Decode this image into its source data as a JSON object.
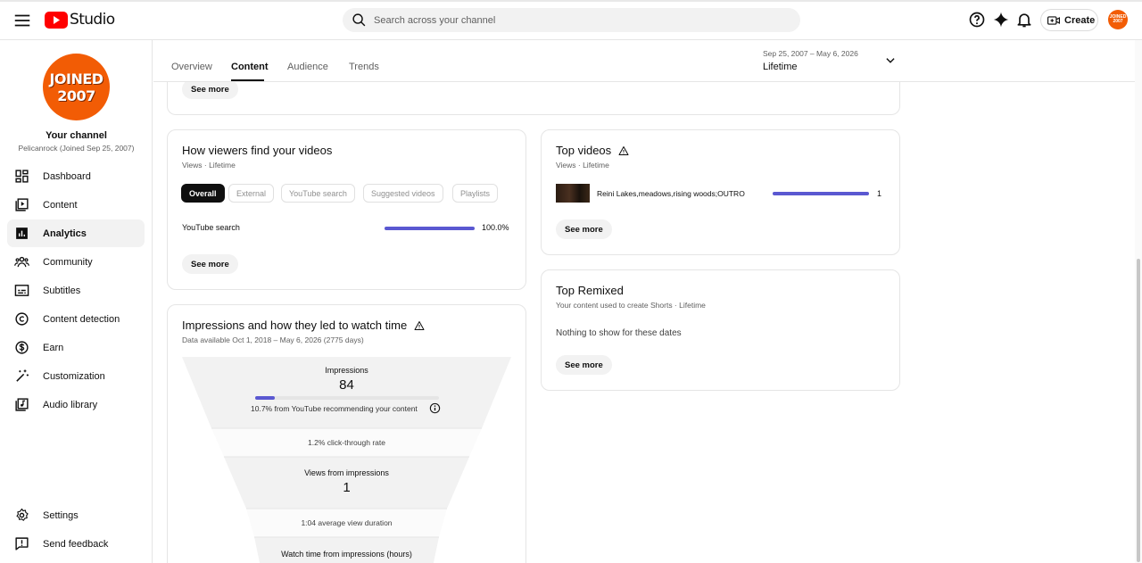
{
  "header": {
    "logo_text": "Studio",
    "search_placeholder": "Search across your channel",
    "create_label": "Create",
    "avatar_text": "JOINED 2007"
  },
  "channel": {
    "avatar_line1": "JOINED",
    "avatar_line2": "2007",
    "title": "Your channel",
    "subtitle": "Pelicanrock (Joined Sep 25, 2007)"
  },
  "sidebar": {
    "items": [
      {
        "label": "Dashboard",
        "icon": "dashboard-icon"
      },
      {
        "label": "Content",
        "icon": "content-icon"
      },
      {
        "label": "Analytics",
        "icon": "analytics-icon",
        "active": true
      },
      {
        "label": "Community",
        "icon": "community-icon"
      },
      {
        "label": "Subtitles",
        "icon": "subtitles-icon"
      },
      {
        "label": "Content detection",
        "icon": "copyright-icon"
      },
      {
        "label": "Earn",
        "icon": "dollar-icon"
      },
      {
        "label": "Customization",
        "icon": "magic-wand-icon"
      },
      {
        "label": "Audio library",
        "icon": "audio-library-icon"
      }
    ],
    "settings_label": "Settings",
    "feedback_label": "Send feedback"
  },
  "tabs": [
    "Overview",
    "Content",
    "Audience",
    "Trends"
  ],
  "active_tab": "Content",
  "date_range": {
    "range": "Sep 25, 2007 – May 6, 2026",
    "label": "Lifetime"
  },
  "top_card": {
    "see_more": "See more"
  },
  "viewers_card": {
    "title": "How viewers find your videos",
    "subtitle": "Views · Lifetime",
    "chips": [
      "Overall",
      "External",
      "YouTube search",
      "Suggested videos",
      "Playlists"
    ],
    "active_chip": "Overall",
    "row_label": "YouTube search",
    "row_value": "100.0%",
    "row_fraction": 1.0,
    "see_more": "See more"
  },
  "impressions_card": {
    "title": "Impressions and how they led to watch time",
    "subtitle": "Data available Oct 1, 2018 – May 6, 2026 (2775 days)",
    "impressions_label": "Impressions",
    "impressions_value": "84",
    "recommend_text": "10.7% from YouTube recommending your content",
    "recommend_fraction": 0.107,
    "ctr_text": "1.2% click-through rate",
    "views_label": "Views from impressions",
    "views_value": "1",
    "avg_duration_text": "1:04 average view duration",
    "watch_time_label": "Watch time from impressions (hours)"
  },
  "top_videos_card": {
    "title": "Top videos",
    "subtitle": "Views · Lifetime",
    "video_title": "Reini Lakes,meadows,rising woods;OUTRO",
    "video_views": "1",
    "video_fraction": 1.0,
    "see_more": "See more"
  },
  "top_remixed_card": {
    "title": "Top Remixed",
    "subtitle": "Your content used to create Shorts · Lifetime",
    "empty_text": "Nothing to show for these dates",
    "see_more": "See more"
  },
  "colors": {
    "accent_bar": "#5a58d1",
    "brand_red": "#ff0000",
    "avatar_orange": "#f25c05"
  }
}
